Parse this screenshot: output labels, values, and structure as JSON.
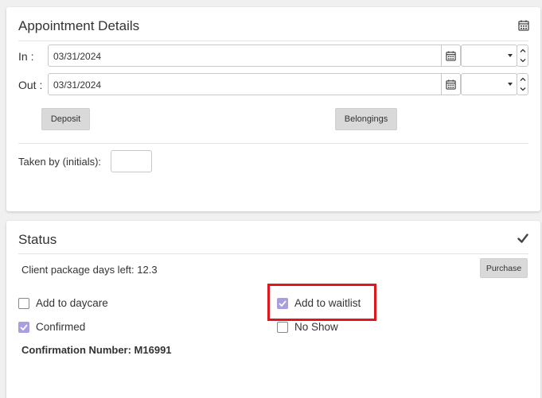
{
  "appointment": {
    "title": "Appointment Details",
    "header_icon": "calendar-icon",
    "in_label": "In :",
    "in_date": "03/31/2024",
    "in_time": "",
    "out_label": "Out :",
    "out_date": "03/31/2024",
    "out_time": "",
    "deposit_label": "Deposit",
    "belongings_label": "Belongings",
    "taken_by_label": "Taken by (initials):",
    "taken_by_value": ""
  },
  "status": {
    "title": "Status",
    "header_icon": "checkmark-icon",
    "package_days_text": "Client package days left: 12.3",
    "purchase_label": "Purchase",
    "checkboxes": {
      "daycare": {
        "label": "Add to daycare",
        "checked": false
      },
      "waitlist": {
        "label": "Add to waitlist",
        "checked": true
      },
      "confirmed": {
        "label": "Confirmed",
        "checked": true
      },
      "no_show": {
        "label": "No Show",
        "checked": false
      }
    },
    "confirmation_text": "Confirmation Number: M16991"
  },
  "colors": {
    "checkbox_checked": "#a89ee0",
    "highlight": "#e0161f",
    "button_gray": "#d9d9d9"
  }
}
